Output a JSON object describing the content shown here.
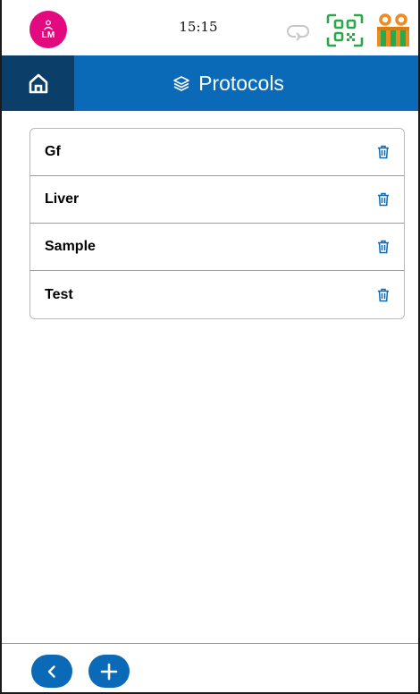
{
  "status_bar": {
    "avatar_initials": "LM",
    "time": "15:15",
    "icons": [
      "user-icon",
      "sync-icon",
      "qr-code-icon",
      "gift-icon"
    ]
  },
  "header": {
    "home_icon": "home-icon",
    "title_icon": "layers-icon",
    "title": "Protocols"
  },
  "protocols": [
    {
      "name": "Gf"
    },
    {
      "name": "Liver"
    },
    {
      "name": "Sample"
    },
    {
      "name": "Test"
    }
  ],
  "footer": {
    "back_icon": "chevron-left-icon",
    "add_icon": "plus-icon"
  },
  "colors": {
    "primary": "#0a6ab8",
    "home_button": "#0b3e68",
    "avatar": "#e3097f",
    "qr_icon": "#2aa84a",
    "gift_icon": "#f08a1c",
    "sync_icon": "#c8c8c8"
  }
}
